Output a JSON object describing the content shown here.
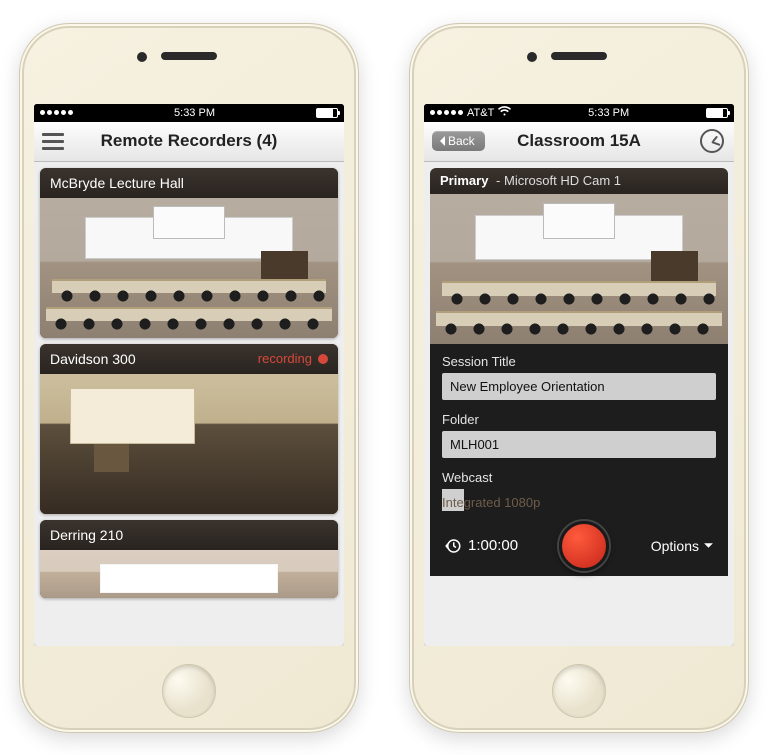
{
  "statusbar": {
    "carrier": "AT&T",
    "time": "5:33 PM"
  },
  "left": {
    "title": "Remote Recorders (4)",
    "cards": [
      {
        "name": "McBryde Lecture Hall",
        "status": ""
      },
      {
        "name": "Davidson 300",
        "status": "recording"
      },
      {
        "name": "Derring 210",
        "status": ""
      }
    ]
  },
  "right": {
    "back": "Back",
    "title": "Classroom 15A",
    "camera": {
      "role": "Primary",
      "name": "Microsoft HD Cam 1"
    },
    "form": {
      "session_label": "Session Title",
      "session_value": "New Employee Orientation",
      "folder_label": "Folder",
      "folder_value": "MLH001",
      "webcast_label": "Webcast",
      "integrated": "Integrated 1080p"
    },
    "controls": {
      "duration": "1:00:00",
      "options_label": "Options"
    }
  }
}
